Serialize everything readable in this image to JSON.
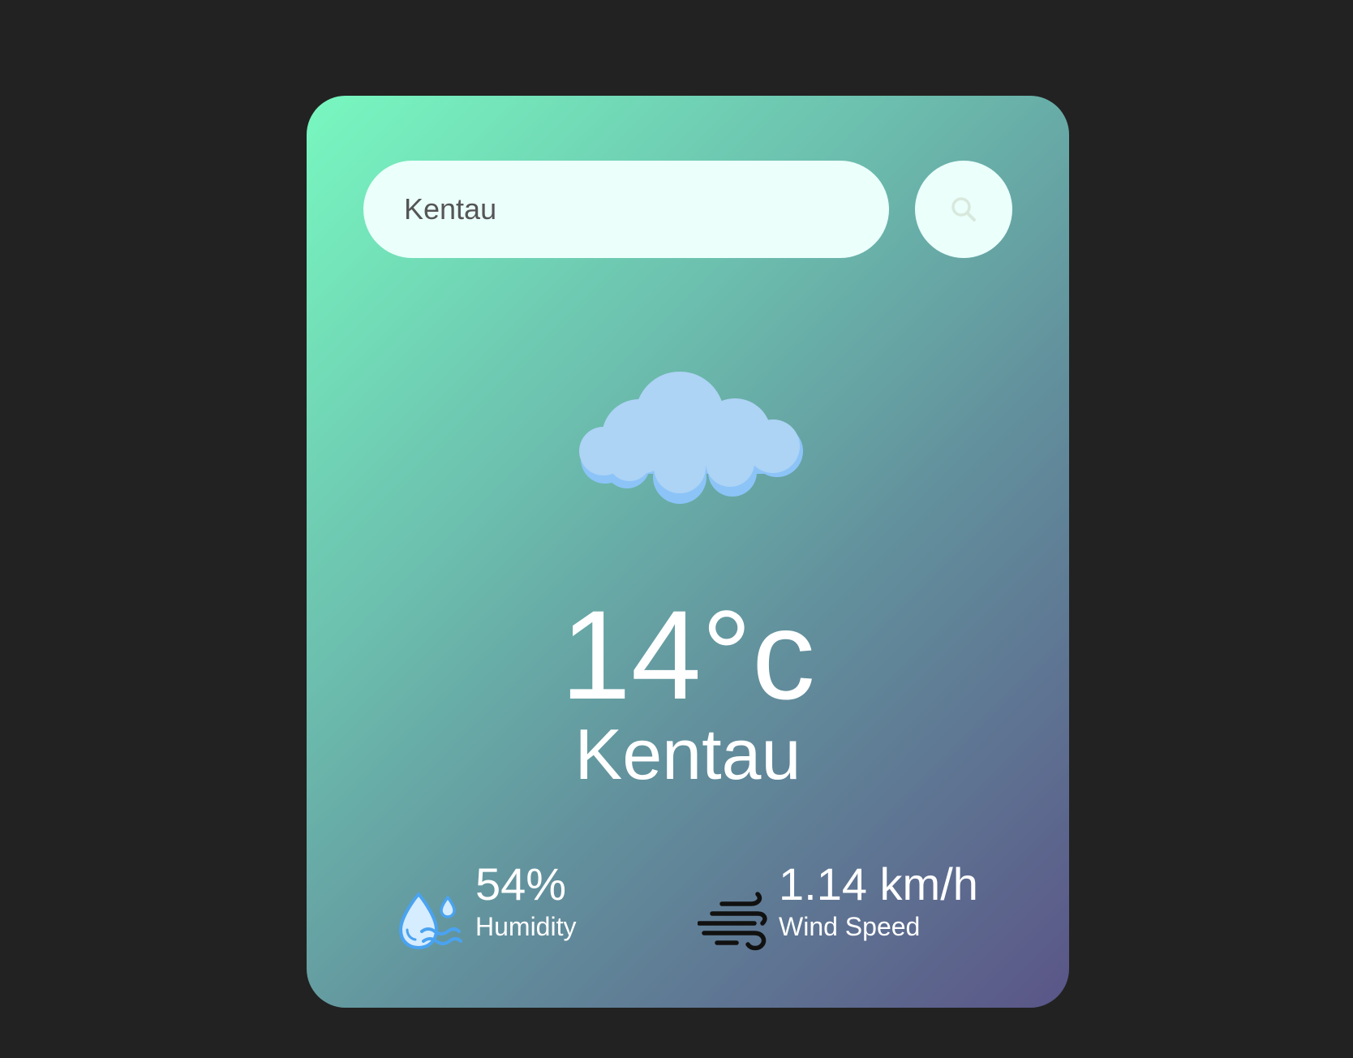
{
  "search": {
    "value": "Kentau",
    "button_icon": "search-icon"
  },
  "weather": {
    "icon": "cloud-icon",
    "temperature": "14°c",
    "city": "Kentau"
  },
  "details": {
    "humidity": {
      "icon": "humidity-icon",
      "value": "54%",
      "label": "Humidity"
    },
    "wind": {
      "icon": "wind-icon",
      "value": "1.14 km/h",
      "label": "Wind Speed"
    }
  },
  "colors": {
    "page_background": "#222222",
    "gradient_start": "#78f8c0",
    "gradient_end": "#5a5587",
    "input_background": "#ebfffb",
    "cloud": "#add3f5",
    "cloud_shadow": "#8cc4f8",
    "text": "#ffffff"
  }
}
